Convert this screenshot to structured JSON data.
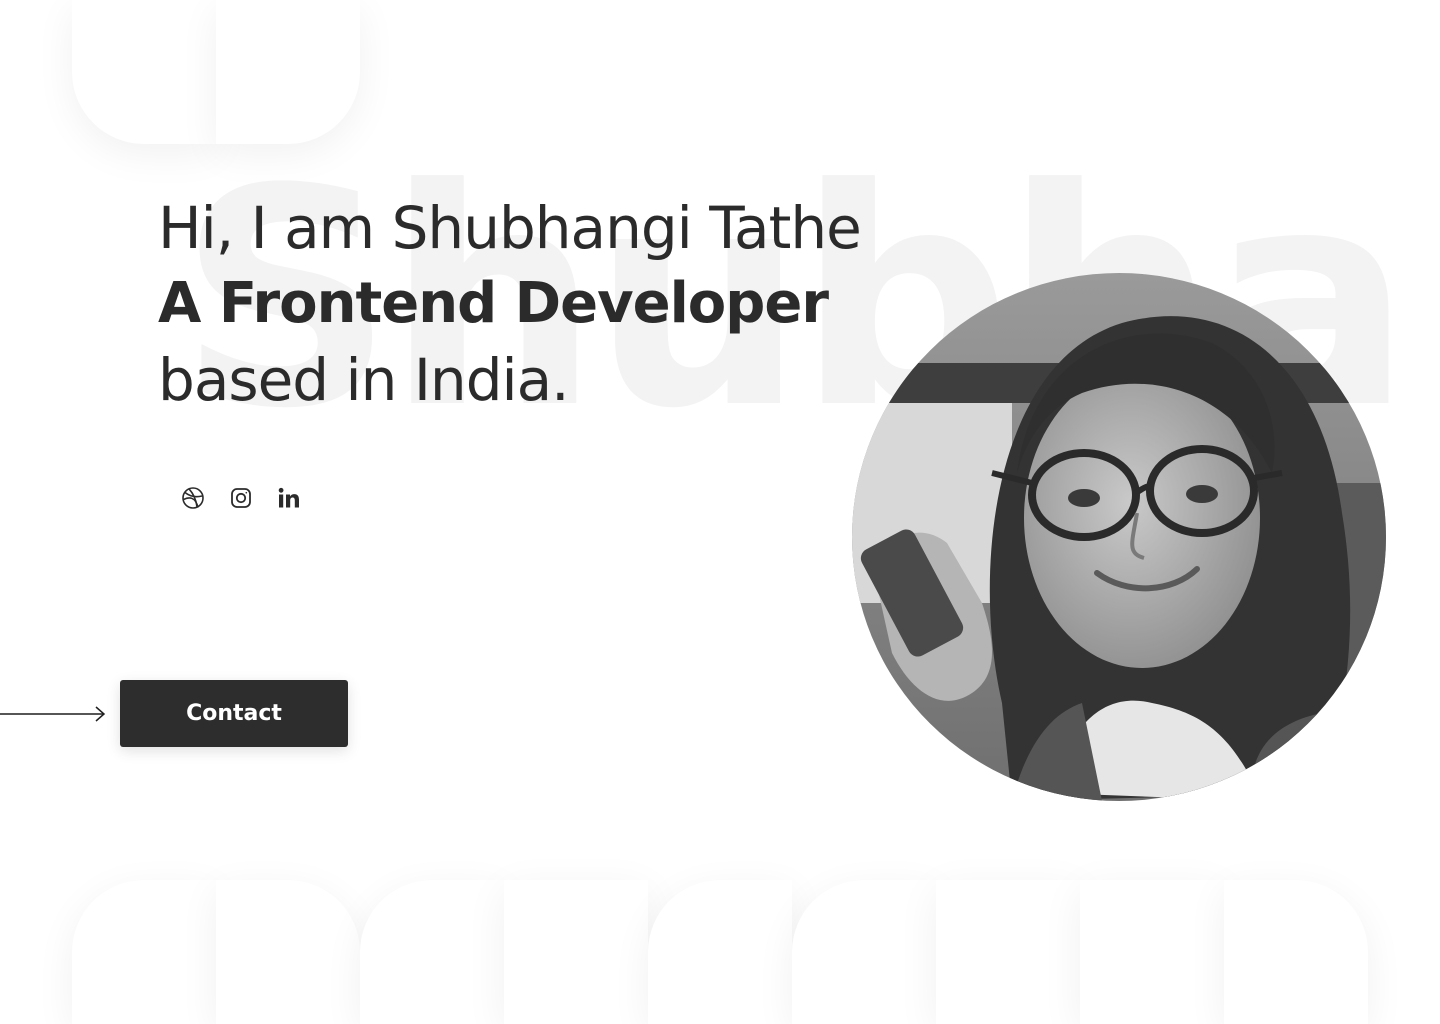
{
  "hero": {
    "background_word": "Shubha",
    "greeting": "Hi, I am Shubhangi Tathe",
    "role": "A Frontend Developer",
    "location": "based in India."
  },
  "socials": [
    {
      "icon": "dribbble-icon"
    },
    {
      "icon": "instagram-icon"
    },
    {
      "icon": "linkedin-icon"
    }
  ],
  "contact": {
    "label": "Contact"
  },
  "colors": {
    "text": "#2b2b2b",
    "button_bg": "#2d2d2d",
    "button_text": "#ffffff",
    "background": "#ffffff"
  }
}
